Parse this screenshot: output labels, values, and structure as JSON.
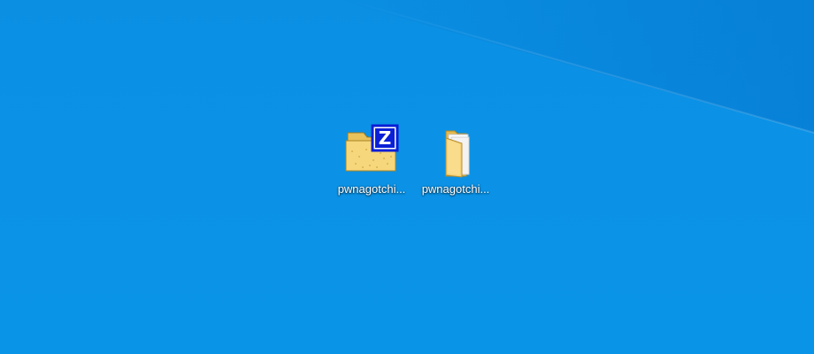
{
  "desktop": {
    "background_color": "#0a8fe3",
    "icons": [
      {
        "label": "pwnagotchi...",
        "icon": "zip-archive-folder-icon",
        "badge_letter": "Z",
        "badge_color": "#0a1fd6"
      },
      {
        "label": "pwnagotchi...",
        "icon": "folder-icon"
      }
    ]
  }
}
